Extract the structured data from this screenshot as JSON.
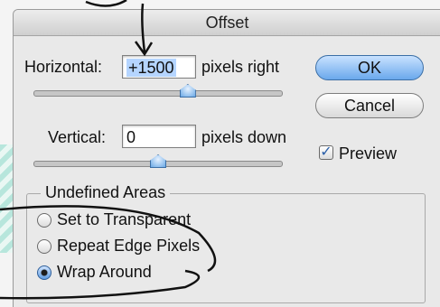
{
  "dialog": {
    "title": "Offset",
    "horizontal": {
      "label": "Horizontal:",
      "value": "+1500",
      "unit": "pixels right",
      "slider_position": 0.62
    },
    "vertical": {
      "label": "Vertical:",
      "value": "0",
      "unit": "pixels down",
      "slider_position": 0.5
    },
    "buttons": {
      "ok": "OK",
      "cancel": "Cancel"
    },
    "preview": {
      "label": "Preview",
      "checked": true
    },
    "undefined_areas": {
      "title": "Undefined Areas",
      "options": [
        {
          "label": "Set to Transparent",
          "selected": false
        },
        {
          "label": "Repeat Edge Pixels",
          "selected": false
        },
        {
          "label": "Wrap Around",
          "selected": true
        }
      ]
    }
  },
  "colors": {
    "accent": "#6aa8ec",
    "selection": "#b5d5ff",
    "annotation_ink": "#111111"
  }
}
